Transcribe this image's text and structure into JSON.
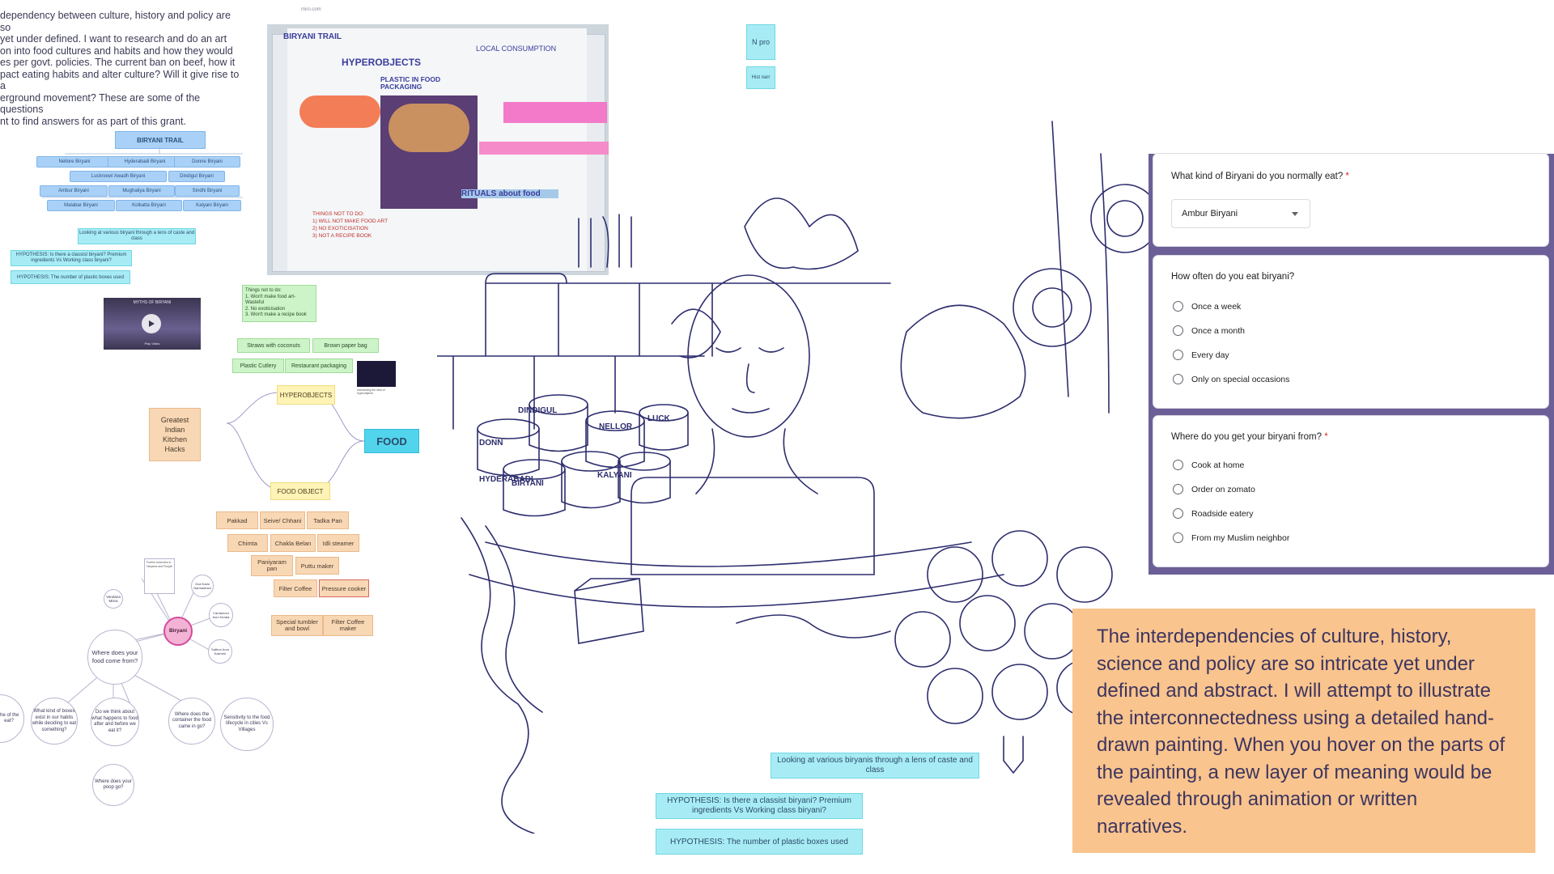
{
  "intro_text": "dependency between culture, history and policy are so\nyet under defined. I want to research and do an art\non into food cultures and habits and how they would\nes per govt. policies. The current ban on beef, how it\npact eating habits and alter culture? Will it give rise to a\nerground movement? These are some of the questions\nnt to find answers for as part of this grant.",
  "miro_label": "miro.com",
  "biryani_trail": {
    "title": "BIRYANI TRAIL",
    "rows": [
      [
        "Nellore Biryani",
        "Hyderabadi Biryani",
        "Donne Biryani"
      ],
      [
        "Lucknowi/ Awadh Biryani",
        "Dindigul Biryani"
      ],
      [
        "Ambur Biryani",
        "Mughaliya Biryani",
        "Sindhi Biryani"
      ],
      [
        "Malabar Biryani",
        "Kolkatta Biryani",
        "Kalyani Biryani"
      ]
    ],
    "lens_note": "Looking at various biryani through a lens of caste and class",
    "hypothesis1": "HYPOTHESIS: Is there a classist biryani? Premium ingredients Vs Working class biryani?",
    "hypothesis2": "HYPOTHESIS: The number of plastic boxes used"
  },
  "video": {
    "title": "MYTHS OF BIRYANI",
    "caption": "Play Video"
  },
  "things_not_to_do": "Things not to do:\n1. Won't make food art- Wasteful\n2. No exoticisation\n3. Won't make a recipe book",
  "mind_map": {
    "greatest_hacks": "Greatest Indian Kitchen Hacks",
    "hyperobjects": "HYPEROBJECTS",
    "food": "FOOD",
    "food_object": "FOOD OBJECT",
    "top_chips": [
      "Straws with coconuts",
      "Brown paper bag",
      "Plastic Cutlery",
      "Restaurant packaging"
    ],
    "image_caption": "Introducing the idea of hyperobjects",
    "objects": [
      "Pakkad",
      "Seive/ Chhani",
      "Tadka Pan",
      "Chimta",
      "Chakla Belan",
      "Idli steamer",
      "Paniyaram pan",
      "Puttu maker",
      "Filter Coffee",
      "Pressure cooker",
      "Special tumbler and bowl",
      "Filter Coffee maker"
    ]
  },
  "biryani_web": {
    "center": "Biryani",
    "nodes": [
      "Vandana Misra",
      "Goa Kadu Narmadhavi",
      "Cardamom from Kerala",
      "Saffron from Kashmir",
      "Further branches in Haryana and Punjab"
    ],
    "questions": [
      "Where does your food come from?",
      "What kind of boxes exist in our habits while deciding to eat something?",
      "Do we think about what happens to food after and before we eat it?",
      "Where does the container the food came in go?",
      "Sensitivity to the food lifecycle in cities Vs Villages",
      "Where does your poop go?",
      "the of the eat?"
    ]
  },
  "center_notes": {
    "lens_note": "Looking at various biryanis through a lens of caste and class",
    "hypothesis1": "HYPOTHESIS: Is there a classist biryani? Premium ingredients Vs Working class biryani?",
    "hypothesis2": "HYPOTHESIS: The number of plastic boxes used",
    "top_note1": "N pro",
    "top_note2": "Hist narr"
  },
  "collage_text": {
    "trail": "BIRYANI TRAIL",
    "hyperobjects": "HYPEROBJECTS",
    "plastic": "PLASTIC IN FOOD PACKAGING",
    "rituals": "RITUALS about food",
    "local": "LOCAL CONSUMPTION",
    "notes": "THINGS NOT TO DO:\n1) WILL NOT MAKE FOOD ART\n2) NO EXOTICISATION\n3) NOT A RECIPE BOOK"
  },
  "form": {
    "q1": "What kind of Biryani do you normally eat?",
    "q1_required": "*",
    "q1_value": "Ambur Biryani",
    "q2": "How often do you eat biryani?",
    "q2_options": [
      "Once a week",
      "Once a month",
      "Every day",
      "Only on special occasions"
    ],
    "q3": "Where do you get your biryani from?",
    "q3_required": "*",
    "q3_options": [
      "Cook at home",
      "Order on zomato",
      "Roadside eatery",
      "From my Muslim neighbor"
    ]
  },
  "statement": "The interdependencies of culture, history, science and policy are so intricate yet under defined and abstract. I will attempt to illustrate the interconnectedness using a detailed hand-drawn painting. When you hover on the parts of the painting, a new layer of meaning would be revealed through animation or written narratives.",
  "illustration_labels": [
    "DINDIGUL",
    "NELLOR",
    "LUCK",
    "DONN",
    "HYDERABADI",
    "BIRYANI",
    "KALYANI"
  ],
  "colors": {
    "form_frame": "#6c5f97",
    "statement_bg": "#f9c48d",
    "line_art": "#2d2d6e",
    "note_cyan": "#a7ecf4"
  }
}
